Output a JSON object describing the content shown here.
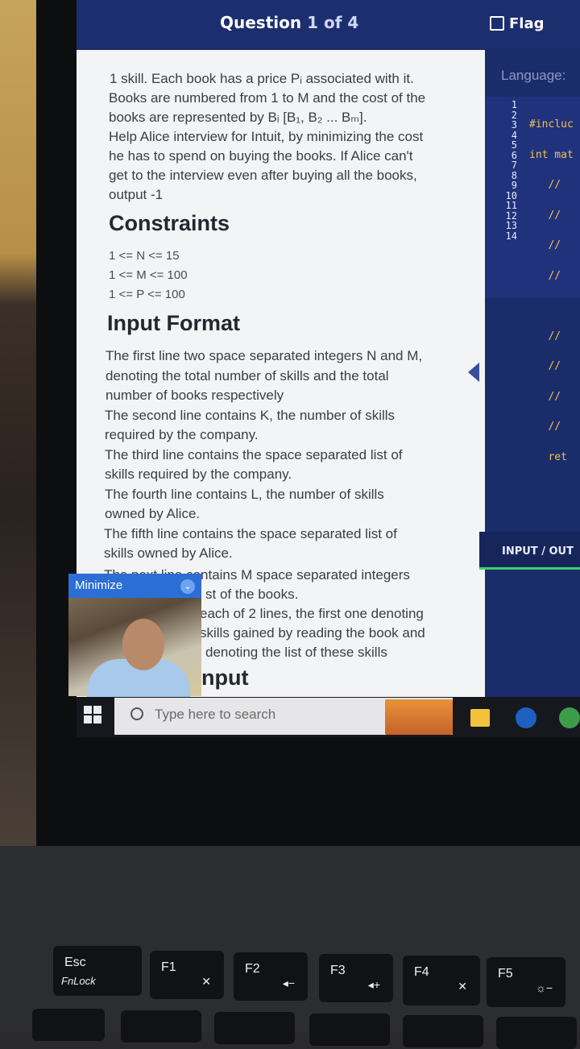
{
  "header": {
    "question_label": "Question",
    "question_number": "1",
    "question_of": "of 4",
    "flag_label": "Flag"
  },
  "problem": {
    "lines_intro": [
      "1 skill. Each book has a price Pᵢ associated with it.",
      "Books are numbered from 1 to M and the cost of the",
      "books are represented by Bᵢ [B₁, B₂ ... Bₘ].",
      "Help Alice interview for Intuit, by minimizing the cost",
      "he has to spend on buying the books. If Alice can't",
      "get to the interview even after buying all the books,",
      "output -1"
    ],
    "constraints_heading": "Constraints",
    "constraints": [
      "1 <= N <= 15",
      "1 <= M <= 100",
      "1 <= P <= 100"
    ],
    "input_heading": "Input Format",
    "input_lines": [
      "The first line two space separated integers N and M,",
      "denoting the total number of skills and the total",
      "number of books respectively",
      "The second line contains K, the number of skills",
      "required by the company.",
      "The third line contains the space separated list of",
      "skills required by the company.",
      "The fourth line contains L, the number of skills",
      "owned by Alice.",
      "The fifth line contains the space separated list of",
      "skills owned by Alice.",
      "The next line contains M space separated integers",
      "st of the books.",
      "each of 2 lines, the first one denoting",
      "skills gained by reading the book and",
      "denoting the list of these skills"
    ],
    "partial_heading": "nput"
  },
  "editor": {
    "language_label": "Language:",
    "line_numbers": [
      "1",
      "2",
      "3",
      "4",
      "5",
      "6",
      "7",
      "8",
      "9",
      "10",
      "11",
      "12",
      "13",
      "14"
    ],
    "code_lines": [
      "#incluc",
      "int mat",
      "   //",
      "   //",
      "   //",
      "   //",
      "",
      "   //",
      "   //",
      "   //",
      "   //",
      "   ret",
      "",
      ""
    ],
    "io_label": "INPUT / OUT"
  },
  "video_overlay": {
    "minimize_label": "Minimize"
  },
  "taskbar": {
    "search_placeholder": "Type here to search"
  },
  "keyboard": {
    "esc": "Esc",
    "fnlock": "FnLock",
    "f1": "F1",
    "f2": "F2",
    "f3": "F3",
    "f4": "F4",
    "f5": "F5"
  }
}
